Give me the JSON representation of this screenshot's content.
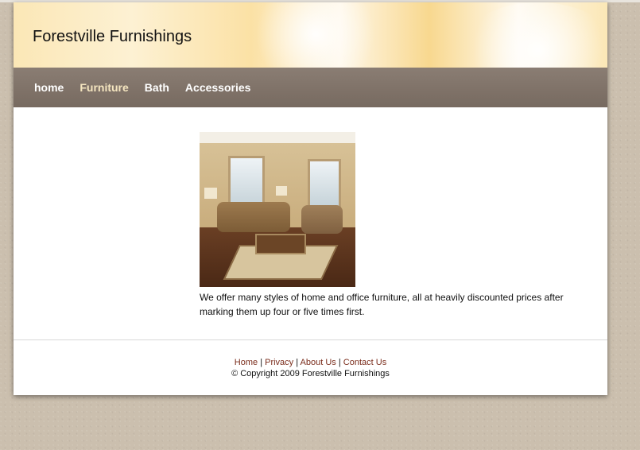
{
  "header": {
    "site_title": "Forestville Furnishings"
  },
  "nav": {
    "items": [
      {
        "label": "home"
      },
      {
        "label": "Furniture"
      },
      {
        "label": "Bath"
      },
      {
        "label": "Accessories"
      }
    ]
  },
  "main": {
    "image_alt": "living room furniture photo",
    "description": "We offer many styles of home and office furniture, all at heavily discounted prices after marking them up four or five times first."
  },
  "footer": {
    "links": [
      {
        "label": "Home"
      },
      {
        "label": "Privacy"
      },
      {
        "label": "About Us"
      },
      {
        "label": "Contact Us"
      }
    ],
    "separator": "|",
    "copyright": "© Copyright 2009 Forestville Furnishings"
  },
  "colors": {
    "nav_bg": "#7d7067",
    "link_color": "#7a2c1b",
    "page_bg": "#cbbfae"
  }
}
